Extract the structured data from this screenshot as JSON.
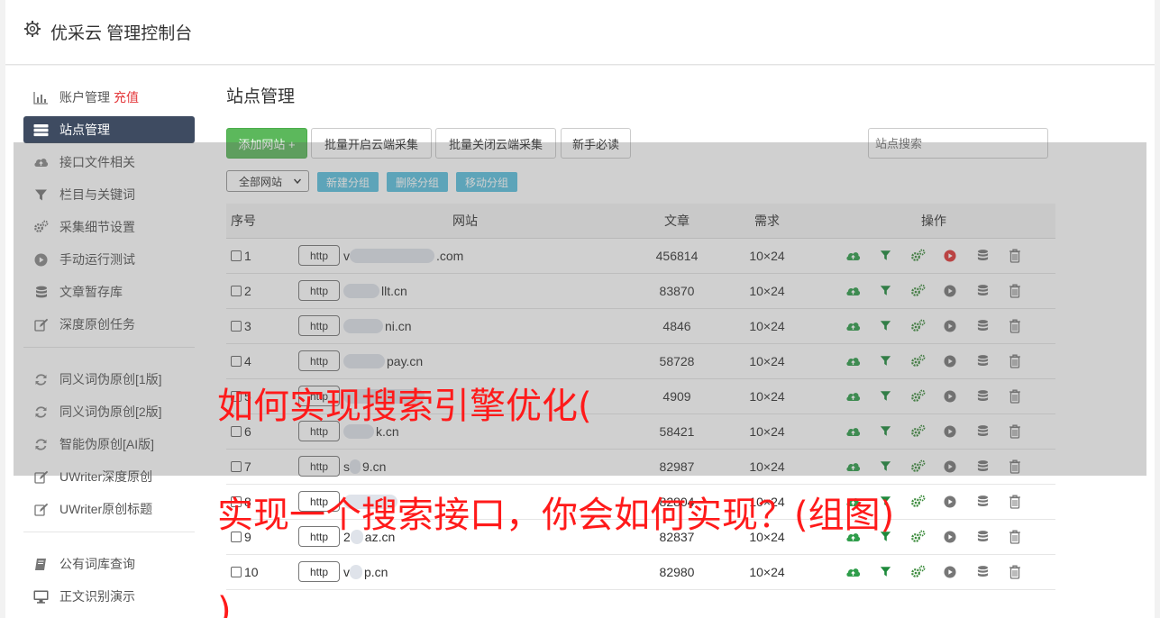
{
  "app": {
    "title": "优采云 管理控制台",
    "icon": "gear-icon"
  },
  "sidebar": {
    "items": [
      {
        "label": "账户管理",
        "extra": "充值",
        "icon": "bar-chart-icon"
      },
      {
        "label": "站点管理",
        "icon": "server-icon",
        "active": true
      },
      {
        "label": "接口文件相关",
        "icon": "cloud-upload-icon"
      },
      {
        "label": "栏目与关键词",
        "icon": "filter-icon"
      },
      {
        "label": "采集细节设置",
        "icon": "gears-icon"
      },
      {
        "label": "手动运行测试",
        "icon": "play-circle-icon"
      },
      {
        "label": "文章暂存库",
        "icon": "database-icon"
      },
      {
        "label": "深度原创任务",
        "icon": "edit-icon"
      }
    ],
    "group2": [
      {
        "label": "同义词伪原创[1版]",
        "icon": "refresh-icon"
      },
      {
        "label": "同义词伪原创[2版]",
        "icon": "refresh-icon"
      },
      {
        "label": "智能伪原创[AI版]",
        "icon": "refresh-icon"
      },
      {
        "label": "UWriter深度原创",
        "icon": "edit-icon"
      },
      {
        "label": "UWriter原创标题",
        "icon": "edit-icon"
      }
    ],
    "group3": [
      {
        "label": "公有词库查询",
        "icon": "book-icon"
      },
      {
        "label": "正文识别演示",
        "icon": "monitor-icon"
      }
    ]
  },
  "main": {
    "title": "站点管理",
    "buttons": {
      "add": "添加网站 +",
      "batch_open": "批量开启云端采集",
      "batch_close": "批量关闭云端采集",
      "newbie": "新手必读"
    },
    "search_placeholder": "站点搜索",
    "group_select": "全部网站",
    "group_buttons": {
      "new": "新建分组",
      "delete": "删除分组",
      "move": "移动分组"
    },
    "table": {
      "headers": {
        "no": "序号",
        "site": "网站",
        "articles": "文章",
        "demand": "需求",
        "ops": "操作"
      },
      "rows": [
        {
          "no": "1",
          "proto": "http",
          "site_start": "v",
          "site_end": ".com",
          "articles": "456814",
          "demand": "10×24",
          "play_active": true
        },
        {
          "no": "2",
          "proto": "http",
          "site_start": "",
          "site_end": "llt.cn",
          "articles": "83870",
          "demand": "10×24"
        },
        {
          "no": "3",
          "proto": "http",
          "site_start": "",
          "site_end": "ni.cn",
          "articles": "4846",
          "demand": "10×24"
        },
        {
          "no": "4",
          "proto": "http",
          "site_start": "",
          "site_end": "pay.cn",
          "articles": "58728",
          "demand": "10×24"
        },
        {
          "no": "5",
          "proto": "http",
          "site_start": "",
          "site_end": "",
          "articles": "4909",
          "demand": "10×24"
        },
        {
          "no": "6",
          "proto": "http",
          "site_start": "",
          "site_end": "k.cn",
          "articles": "58421",
          "demand": "10×24"
        },
        {
          "no": "7",
          "proto": "http",
          "site_start": "s",
          "site_end": "9.cn",
          "articles": "82987",
          "demand": "10×24"
        },
        {
          "no": "8",
          "proto": "http",
          "site_start": "",
          "site_end": "",
          "articles": "82804",
          "demand": "10×24"
        },
        {
          "no": "9",
          "proto": "http",
          "site_start": "2",
          "site_end": "az.cn",
          "articles": "82837",
          "demand": "10×24"
        },
        {
          "no": "10",
          "proto": "http",
          "site_start": "v",
          "site_end": "p.cn",
          "articles": "82980",
          "demand": "10×24"
        }
      ]
    }
  },
  "watermark": {
    "line1": "如何实现搜索引擎优化(",
    "line2": "实现一个搜索接口，你会如何实现？(组图)",
    "line3": ")"
  },
  "colors": {
    "active_nav": "#3e4b61",
    "green_button": "#5cb85c",
    "info_button": "#5bc0de",
    "link_blue": "#3a6fb2",
    "watermark": "#ff1a1a"
  }
}
